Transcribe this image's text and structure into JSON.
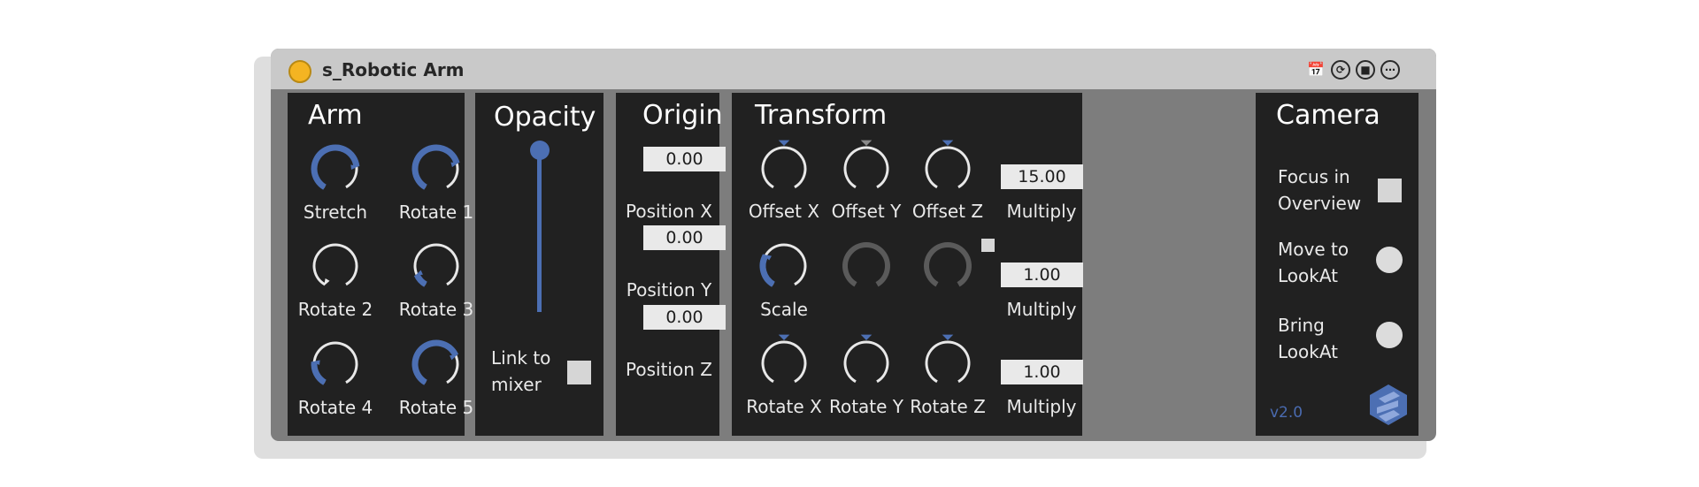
{
  "device": {
    "title": "s_Robotic Arm",
    "header_icons": [
      "calendar-icon",
      "refresh-icon",
      "save-icon",
      "more-icon"
    ]
  },
  "colors": {
    "accent": "#4c6fb3",
    "panel": "#212121",
    "frame": "#7d7d7d",
    "titlebar": "#c9c9c9",
    "power": "#f4b422"
  },
  "arm": {
    "title": "Arm",
    "knobs": [
      {
        "label": "Stretch",
        "value": 0.78
      },
      {
        "label": "Rotate 1",
        "value": 0.75
      },
      {
        "label": "Rotate 2",
        "value": 0.0
      },
      {
        "label": "Rotate 3",
        "value": 0.12
      },
      {
        "label": "Rotate 4",
        "value": 0.22
      },
      {
        "label": "Rotate 5",
        "value": 0.72
      }
    ]
  },
  "opacity": {
    "title": "Opacity",
    "value": 1.0,
    "link_label_1": "Link to",
    "link_label_2": "mixer"
  },
  "origin": {
    "title": "Origin",
    "fields": [
      {
        "label": "Position X",
        "value": "0.00"
      },
      {
        "label": "Position Y",
        "value": "0.00"
      },
      {
        "label": "Position Z",
        "value": "0.00"
      }
    ]
  },
  "transform": {
    "title": "Transform",
    "row1": [
      {
        "label": "Offset X",
        "value": 0.5
      },
      {
        "label": "Offset Y",
        "value": 0.5
      },
      {
        "label": "Offset Z",
        "value": 0.5
      }
    ],
    "row2": [
      {
        "label": "Scale",
        "value": 0.3
      },
      {
        "label": "",
        "value": 0.0
      },
      {
        "label": "",
        "value": 0.0
      }
    ],
    "row3": [
      {
        "label": "Rotate X",
        "value": 0.5
      },
      {
        "label": "Rotate Y",
        "value": 0.5
      },
      {
        "label": "Rotate Z",
        "value": 0.5
      }
    ],
    "multiply": [
      {
        "label": "Multiply",
        "value": "15.00"
      },
      {
        "label": "Multiply",
        "value": "1.00"
      },
      {
        "label": "Multiply",
        "value": "1.00"
      }
    ]
  },
  "camera": {
    "title": "Camera",
    "focus_1": "Focus in",
    "focus_2": "Overview",
    "move_1": "Move to",
    "move_2": "LookAt",
    "bring_1": "Bring",
    "bring_2": "LookAt",
    "version": "v2.0"
  }
}
